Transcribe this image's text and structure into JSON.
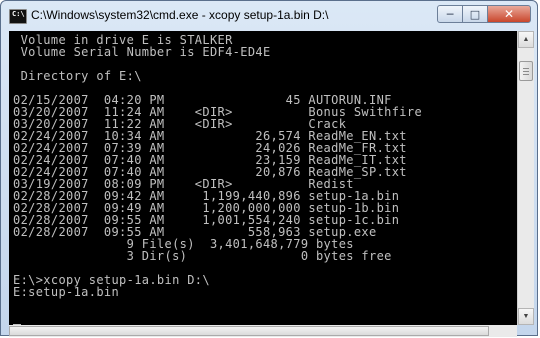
{
  "window": {
    "title": "C:\\Windows\\system32\\cmd.exe - xcopy  setup-1a.bin D:\\",
    "icon_text": "C:\\",
    "controls": {
      "minimize_icon": "minimize-icon",
      "maximize_icon": "maximize-icon",
      "close_icon": "close-icon"
    }
  },
  "console": {
    "lines": [
      " Volume in drive E is STALKER",
      " Volume Serial Number is EDF4-ED4E",
      "",
      " Directory of E:\\",
      "",
      "02/15/2007  04:20 PM                45 AUTORUN.INF",
      "03/20/2007  11:24 AM    <DIR>          Bonus Swithfire",
      "03/20/2007  11:22 AM    <DIR>          Crack",
      "02/24/2007  10:34 AM            26,574 ReadMe_EN.txt",
      "02/24/2007  07:39 AM            24,026 ReadMe_FR.txt",
      "02/24/2007  07:40 AM            23,159 ReadMe_IT.txt",
      "02/24/2007  07:40 AM            20,876 ReadMe_SP.txt",
      "03/19/2007  08:09 PM    <DIR>          Redist",
      "02/28/2007  09:42 AM     1,199,440,896 setup-1a.bin",
      "02/28/2007  09:49 AM     1,200,000,000 setup-1b.bin",
      "02/28/2007  09:55 AM     1,001,554,240 setup-1c.bin",
      "02/28/2007  09:55 AM           558,963 setup.exe",
      "               9 File(s)  3,401,648,779 bytes",
      "               3 Dir(s)               0 bytes free",
      "",
      "E:\\>xcopy setup-1a.bin D:\\",
      "E:setup-1a.bin"
    ]
  },
  "scrollbar": {
    "up_icon": "scroll-up-arrow-icon",
    "down_icon": "scroll-down-arrow-icon"
  }
}
